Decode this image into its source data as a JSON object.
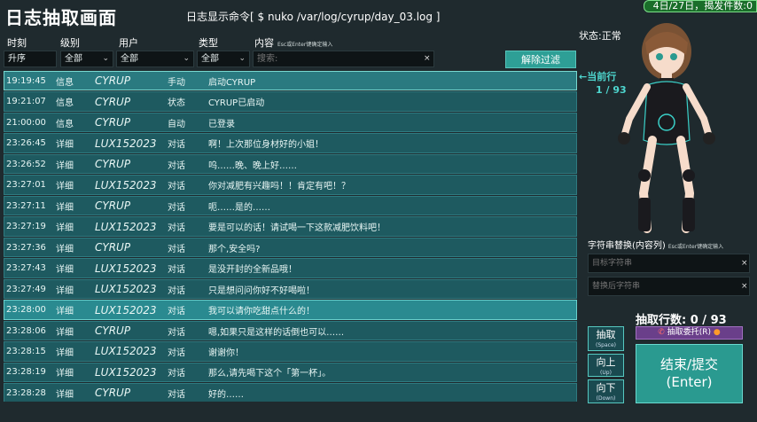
{
  "title": "日志抽取画面",
  "command": "日志显示命令[ $ nuko /var/log/cyrup/day_03.log ]",
  "date_badge": "4日/27日，揭发件数:0",
  "status": "状态:正常",
  "headers": {
    "time": "时刻",
    "level": "级别",
    "user": "用户",
    "type": "类型",
    "content": "内容",
    "content_hint": "Esc或Enter键确定输入"
  },
  "filters": {
    "sort": "升序",
    "level": "全部",
    "user": "全部",
    "type": "全部",
    "search_placeholder": "搜索:",
    "clear": "×",
    "reset_label": "解除过滤"
  },
  "current_row": {
    "label": "←当前行",
    "count": "1 / 93"
  },
  "log_rows": [
    {
      "time": "19:19:45",
      "level": "信息",
      "user": "CYRUP",
      "type": "手动",
      "message": "启动CYRUP"
    },
    {
      "time": "19:21:07",
      "level": "信息",
      "user": "CYRUP",
      "type": "状态",
      "message": "CYRUP已启动"
    },
    {
      "time": "21:00:00",
      "level": "信息",
      "user": "CYRUP",
      "type": "自动",
      "message": "已登录"
    },
    {
      "time": "23:26:45",
      "level": "详细",
      "user": "LUX152023",
      "type": "对话",
      "message": "啊！上次那位身材好的小姐！"
    },
    {
      "time": "23:26:52",
      "level": "详细",
      "user": "CYRUP",
      "type": "对话",
      "message": "呜……晚、晚上好……"
    },
    {
      "time": "23:27:01",
      "level": "详细",
      "user": "LUX152023",
      "type": "对话",
      "message": "你对减肥有兴趣吗！！肯定有吧！？"
    },
    {
      "time": "23:27:11",
      "level": "详细",
      "user": "CYRUP",
      "type": "对话",
      "message": "呃……是的……"
    },
    {
      "time": "23:27:19",
      "level": "详细",
      "user": "LUX152023",
      "type": "对话",
      "message": "要是可以的话！请试喝一下这款减肥饮料吧！"
    },
    {
      "time": "23:27:36",
      "level": "详细",
      "user": "CYRUP",
      "type": "对话",
      "message": "那个,安全吗?"
    },
    {
      "time": "23:27:43",
      "level": "详细",
      "user": "LUX152023",
      "type": "对话",
      "message": "是没开封的全新品哦！"
    },
    {
      "time": "23:27:49",
      "level": "详细",
      "user": "LUX152023",
      "type": "对话",
      "message": "只是想问问你好不好喝啦！"
    },
    {
      "time": "23:28:00",
      "level": "详细",
      "user": "LUX152023",
      "type": "对话",
      "message": "我可以请你吃甜点什么的！"
    },
    {
      "time": "23:28:06",
      "level": "详细",
      "user": "CYRUP",
      "type": "对话",
      "message": "嗯,如果只是这样的话倒也可以……"
    },
    {
      "time": "23:28:15",
      "level": "详细",
      "user": "LUX152023",
      "type": "对话",
      "message": "谢谢你！"
    },
    {
      "time": "23:28:19",
      "level": "详细",
      "user": "LUX152023",
      "type": "对话",
      "message": "那么,请先喝下这个「第一杯」。"
    },
    {
      "time": "23:28:28",
      "level": "详细",
      "user": "CYRUP",
      "type": "对话",
      "message": "好的……"
    }
  ],
  "replace": {
    "label": "字符串替换(内容列)",
    "hint": "Esc或Enter键确定输入",
    "target_placeholder": "目标字符串",
    "replacement_placeholder": "替换后字符串"
  },
  "extract_count": "抽取行数:  0 /  93",
  "entrust_label": "抽取委托(R)",
  "buttons": {
    "extract": "抽取",
    "extract_key": "(Space)",
    "up": "向上",
    "up_key": "(Up)",
    "down": "向下",
    "down_key": "(Down)",
    "submit_line1": "结束/提交",
    "submit_line2": "(Enter)"
  },
  "colors": {
    "accent": "#2a9a90",
    "row_bg": "#1e5a60",
    "highlight": "#2a8a90",
    "badge": "#1a6e2a"
  }
}
